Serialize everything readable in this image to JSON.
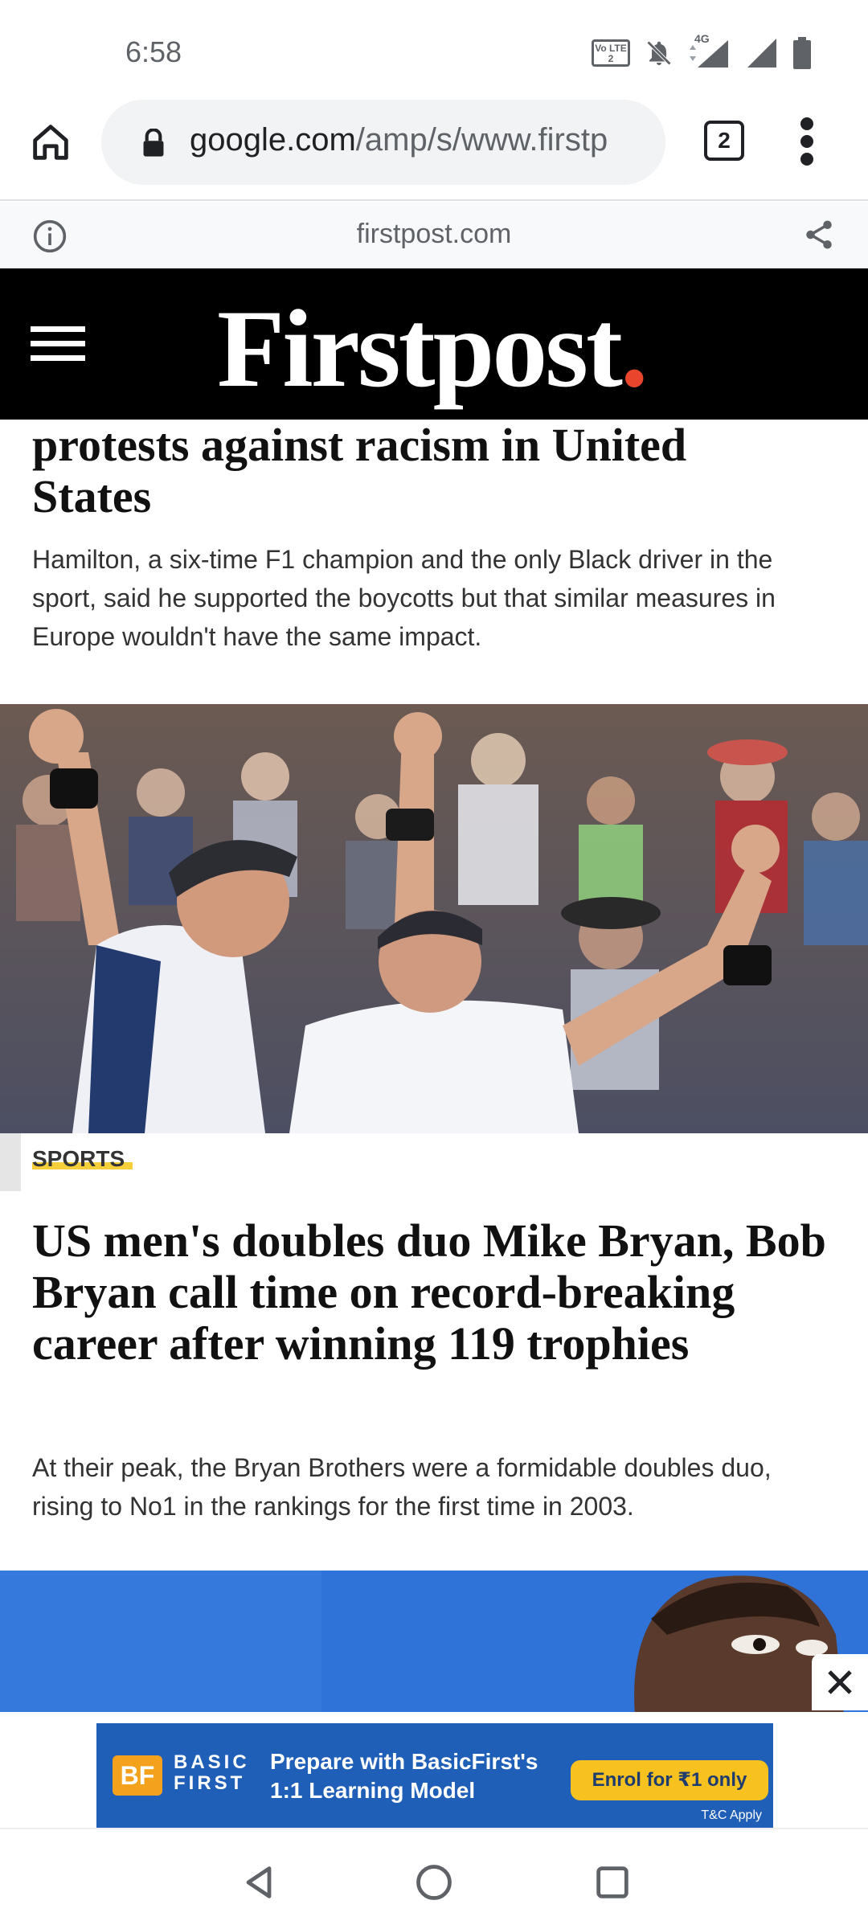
{
  "status_bar": {
    "time": "6:58",
    "volte_label": "Vo LTE 2",
    "network_label": "4G",
    "icons": [
      "volte-icon",
      "mute-icon",
      "signal-4g-icon",
      "signal-icon",
      "battery-icon"
    ]
  },
  "browser": {
    "url_domain": "google.com",
    "url_path": "/amp/s/www.firstp",
    "tab_count": "2",
    "icons": [
      "home-icon",
      "lock-icon",
      "tabs-icon",
      "more-vert-icon"
    ]
  },
  "amp_bar": {
    "domain": "firstpost.com",
    "icons": [
      "info-icon",
      "share-icon"
    ]
  },
  "site": {
    "logo": "Firstpost",
    "logo_dot": ".",
    "logo_dot_color": "#e8452c"
  },
  "articles": [
    {
      "headline_line1": "protests against racism in United",
      "headline_line2": "States",
      "summary": "Hamilton, a six-time F1 champion and the only Black driver in the sport, said he supported the boycotts but that similar measures in Europe wouldn't have the same impact."
    },
    {
      "category": "SPORTS",
      "headline": "US men's doubles duo Mike Bryan, Bob Bryan call time on record-breaking career after winning 119 trophies",
      "summary": "At their peak, the Bryan Brothers were a formidable doubles duo, rising to No1 in the rankings for the first time in 2003."
    }
  ],
  "ad": {
    "logo_text": "BF",
    "brand_line1": "BASIC",
    "brand_line2": "FIRST",
    "text_line1": "Prepare with BasicFirst's",
    "text_line2": "1:1 Learning Model",
    "cta": "Enrol for ₹1 only",
    "terms": "T&C Apply"
  },
  "nav": {
    "icons": [
      "back-icon",
      "home-circle-icon",
      "recents-icon"
    ]
  }
}
